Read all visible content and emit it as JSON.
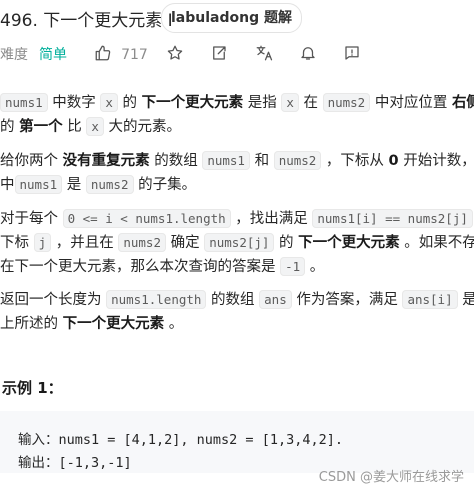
{
  "header": {
    "title": "496. 下一个更大元素 I",
    "tag": "labuladong 题解"
  },
  "meta": {
    "difficulty_label": "难度",
    "difficulty_value": "简单",
    "likes": "717",
    "icons": [
      "thumbs-up-icon",
      "star-icon",
      "share-icon",
      "translate-icon",
      "bell-icon",
      "feedback-icon"
    ]
  },
  "p1": {
    "c1": "nums1",
    "t1": " 中数字 ",
    "c2": "x",
    "t2": " 的 ",
    "b1": "下一个更大元素",
    "t3": " 是指 ",
    "c3": "x",
    "t4": " 在 ",
    "c4": "nums2",
    "t5": " 中对应位置 ",
    "b2": "右侧",
    "l2a": "的 ",
    "b3": "第一个",
    "l2b": " 比 ",
    "c5": "x",
    "l2c": " 大的元素。"
  },
  "p2": {
    "t1": "给你两个 ",
    "b1": "没有重复元素",
    "t2": " 的数组 ",
    "c1": "nums1",
    "t3": " 和 ",
    "c2": "nums2",
    "t4": " ，下标从 ",
    "b2": "0",
    "t5": " 开始计数，其",
    "l2a": "中",
    "c3": "nums1",
    "l2b": " 是 ",
    "c4": "nums2",
    "l2c": " 的子集。"
  },
  "p3": {
    "t1": "对于每个 ",
    "c1": "0 <= i < nums1.length",
    "t2": " ，找出满足 ",
    "c2": "nums1[i] == nums2[j]",
    "t3": " 的",
    "l2a": "下标 ",
    "c3": "j",
    "l2b": " ，并且在 ",
    "c4": "nums2",
    "l2c": " 确定 ",
    "c5": "nums2[j]",
    "l2d": " 的 ",
    "b1": "下一个更大元素",
    "l2e": " 。如果不存",
    "l3a": "在下一个更大元素，那么本次查询的答案是 ",
    "c6": "-1",
    "l3b": " 。"
  },
  "p4": {
    "t1": "返回一个长度为 ",
    "c1": "nums1.length",
    "t2": " 的数组 ",
    "c2": "ans",
    "t3": " 作为答案，满足 ",
    "c3": "ans[i]",
    "t4": " 是如",
    "l2a": "上所述的 ",
    "b1": "下一个更大元素",
    "l2b": " 。"
  },
  "example": {
    "title": "示例 1：",
    "line1": "输入：nums1 = [4,1,2], nums2 = [1,3,4,2].",
    "line2": "输出：[-1,3,-1]"
  },
  "watermark": "CSDN @姜大师在线求学"
}
